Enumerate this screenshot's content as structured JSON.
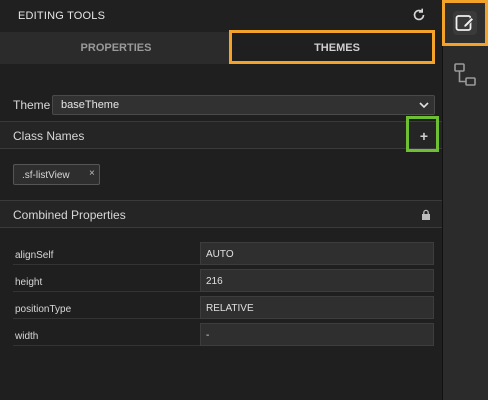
{
  "header": {
    "title": "EDITING TOOLS",
    "refresh_icon": "refresh-icon"
  },
  "tabs": [
    {
      "label": "PROPERTIES"
    },
    {
      "label": "THEMES"
    }
  ],
  "theme": {
    "label": "Theme",
    "selected": "baseTheme"
  },
  "class_names": {
    "title": "Class Names",
    "add_label": "+",
    "chips": [
      {
        "label": ".sf-listView",
        "remove": "×"
      }
    ]
  },
  "combined": {
    "title": "Combined Properties",
    "rows": [
      {
        "key": "alignSelf",
        "value": "AUTO"
      },
      {
        "key": "height",
        "value": "216"
      },
      {
        "key": "positionType",
        "value": "RELATIVE"
      },
      {
        "key": "width",
        "value": "-"
      }
    ]
  },
  "colors": {
    "highlight_orange": "#f3a32a",
    "highlight_green": "#6fbf35",
    "panel_bg": "#1f1f1f"
  }
}
